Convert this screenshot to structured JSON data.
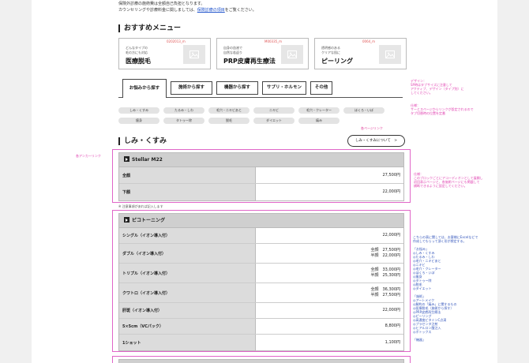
{
  "notice": {
    "line1": "保険外診療の施術費は全額自己負担となります。",
    "line2_prefix": "カウンセリングや診療料金に関しましては、",
    "line2_link": "保険診療の項目",
    "line2_suffix": "をご覧ください。"
  },
  "recommend": {
    "title": "おすすめメニュー",
    "cards": [
      {
        "code": "0202013_m",
        "small": "どんなタイプの\n毛の方にも対応",
        "big": "医療脱毛"
      },
      {
        "code": "M00335_m",
        "small": "自身の血液で\n自然な若返り",
        "big": "PRP皮膚再生療法"
      },
      {
        "code": "0064_m",
        "small": "透明感のある\nクリアな肌に",
        "big": "ピーリング"
      }
    ]
  },
  "tabs": [
    "お悩みから探す",
    "施術から探す",
    "機器から探す",
    "サプリ・ホルモン",
    "その他"
  ],
  "pills_row1": [
    "しみ・くすみ",
    "たるみ・しわ",
    "毛穴・ニキビあと",
    "ニキビ",
    "毛穴・クレーター",
    "ほくろ・いぼ"
  ],
  "pills_row2": [
    "痩身",
    "タトゥー除",
    "脱毛",
    "ダイエット",
    "痛み"
  ],
  "page_link": "各ページリンク",
  "category": {
    "title": "しみ・くすみ",
    "about_button": "しみ・くすみについて　>"
  },
  "table1": {
    "title": "Stellar M22",
    "rows": [
      {
        "name": "全顔",
        "price": [
          "27,500円"
        ]
      },
      {
        "name": "下顔",
        "price": [
          "22,000円"
        ]
      }
    ]
  },
  "note_under": "※ 注意事項があれば記入します",
  "table2": {
    "title": "ピコトーニング",
    "rows": [
      {
        "name": "シングル（イオン導入付）",
        "price": [
          "22,000円"
        ]
      },
      {
        "name": "ダブル（イオン導入付）",
        "price": [
          "全顔　27,500円",
          "半顔　22,000円"
        ]
      },
      {
        "name": "トリプル（イオン導入付）",
        "price": [
          "全顔　33,000円",
          "半顔　25,300円"
        ]
      },
      {
        "name": "クワトロ（イオン導入付）",
        "price": [
          "全顔　36,300円",
          "半顔　27,500円"
        ]
      },
      {
        "name": "肝斑（イオン導入付）",
        "price": [
          "22,000円"
        ]
      },
      {
        "name": "5×5cm（VCパック）",
        "price": [
          "8,800円"
        ]
      },
      {
        "name": "1ショット",
        "price": [
          "1,100円"
        ]
      }
    ]
  },
  "annotations": {
    "ann1": "デザイン：\nSP時はタブサイズに注意して\nアクティブ、デザイン（タイプ別）に\nしてください。",
    "ann2": "仕様：\nサーとスページからリンクが設定されるので\nタブ切替時の位置を定番",
    "ann3": "仕様：\nこのブロックごとにアコーディオンとして展開し\n初回表示ページと、各施術ページにも掲載して\n横断できるように設定してください。",
    "left": "各アンカーリンク",
    "blue_intro": "こちらの表に関しては、お客様にExcelなどで\n作成してもらって頂く形が想定する。",
    "blue_list": "「お悩み」\n◎しみ・くすみ\n◎たるみ・しわ\n◎毛穴・ニキビあと\n◎ニキビ\n◎毛穴・クレーター\n◎ほくろ・いぼ\n◎痩身\n◎タトゥー除\n◎脱毛\n◎ダイエット\n\n「施術」\n◎アートメイク\n◎解約の「痛み」に関するもの\n◎医療脱毛（施術から探す）\n◎PRP皮膚再生療法\n◎ピーリング\n◎高濃度ビタミンC点滴\n◎プラセンタ注射\n◎ヒアルロン酸注入\n◎ボトックス\n\n「機器」"
  }
}
